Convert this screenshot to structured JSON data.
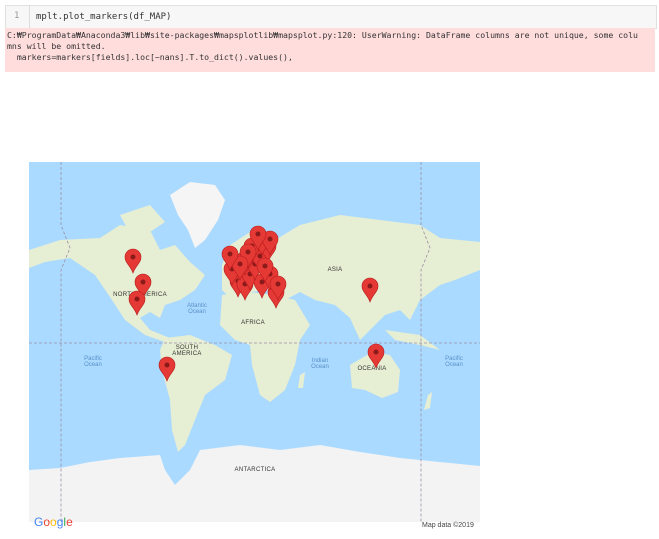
{
  "cell": {
    "line_number": "1",
    "code": "mplt.plot_markers(df_MAP)"
  },
  "stderr": {
    "lines": [
      "C:₩ProgramData₩Anaconda3₩lib₩site-packages₩mapsplotlib₩mapsplot.py:120: UserWarning: DataFrame columns are not unique, some colu",
      "mns will be omitted.",
      "  markers=markers[fields].loc[~nans].T.to_dict().values(),"
    ]
  },
  "map": {
    "labels": {
      "asia": "ASIA",
      "africa": "AFRICA",
      "south_america": "SOUTH AMERICA",
      "north_america": "NORTH AMERICA",
      "oceania": "OCEANIA",
      "antarctica": "ANTARCTICA",
      "atlantic": "Atlantic Ocean",
      "indian": "Indian Ocean",
      "pacific_left": "Pacific Ocean",
      "pacific_right": "Pacific Ocean"
    },
    "google_logo": "Google",
    "attribution": "Map data ©2019",
    "colors": {
      "water": "#aadaff",
      "land": "#e6eed3",
      "ice": "#f5f5f5",
      "marker": "#e53935"
    },
    "marker_icon": "map-pin-icon"
  }
}
